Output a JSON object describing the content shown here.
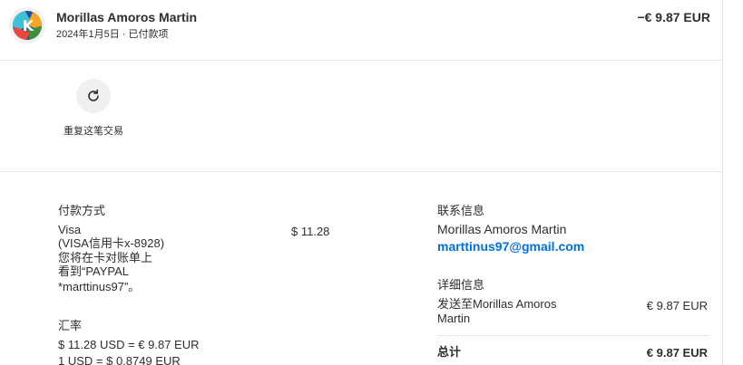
{
  "header": {
    "merchant": "Morillas Amoros Martin",
    "subline": "2024年1月5日 · 已付款项",
    "amount": "−€ 9.87 EUR"
  },
  "repeat": {
    "icon": "refresh-icon",
    "label": "重复这笔交易"
  },
  "payment_method": {
    "title": "付款方式",
    "lines": [
      "Visa",
      "(VISA信用卡x-8928)",
      "您将在卡对账单上",
      "看到“PAYPAL",
      "*marttinus97”。"
    ],
    "amount": "$ 11.28"
  },
  "exchange": {
    "title": "汇率",
    "lines": [
      "$ 11.28 USD = € 9.87 EUR",
      "1 USD = $ 0.8749 EUR"
    ]
  },
  "contact": {
    "title": "联系信息",
    "name": "Morillas Amoros Martin",
    "email": "marttinus97@gmail.com"
  },
  "details": {
    "title": "详细信息",
    "lines": [
      "发送至Morillas Amoros",
      "Martin"
    ],
    "amount": "€ 9.87 EUR",
    "total_label": "总计",
    "total_amount": "€ 9.87 EUR"
  },
  "colors": {
    "link": "#0070e0",
    "text": "#2c2e2f",
    "divider": "#e9e9e9"
  }
}
